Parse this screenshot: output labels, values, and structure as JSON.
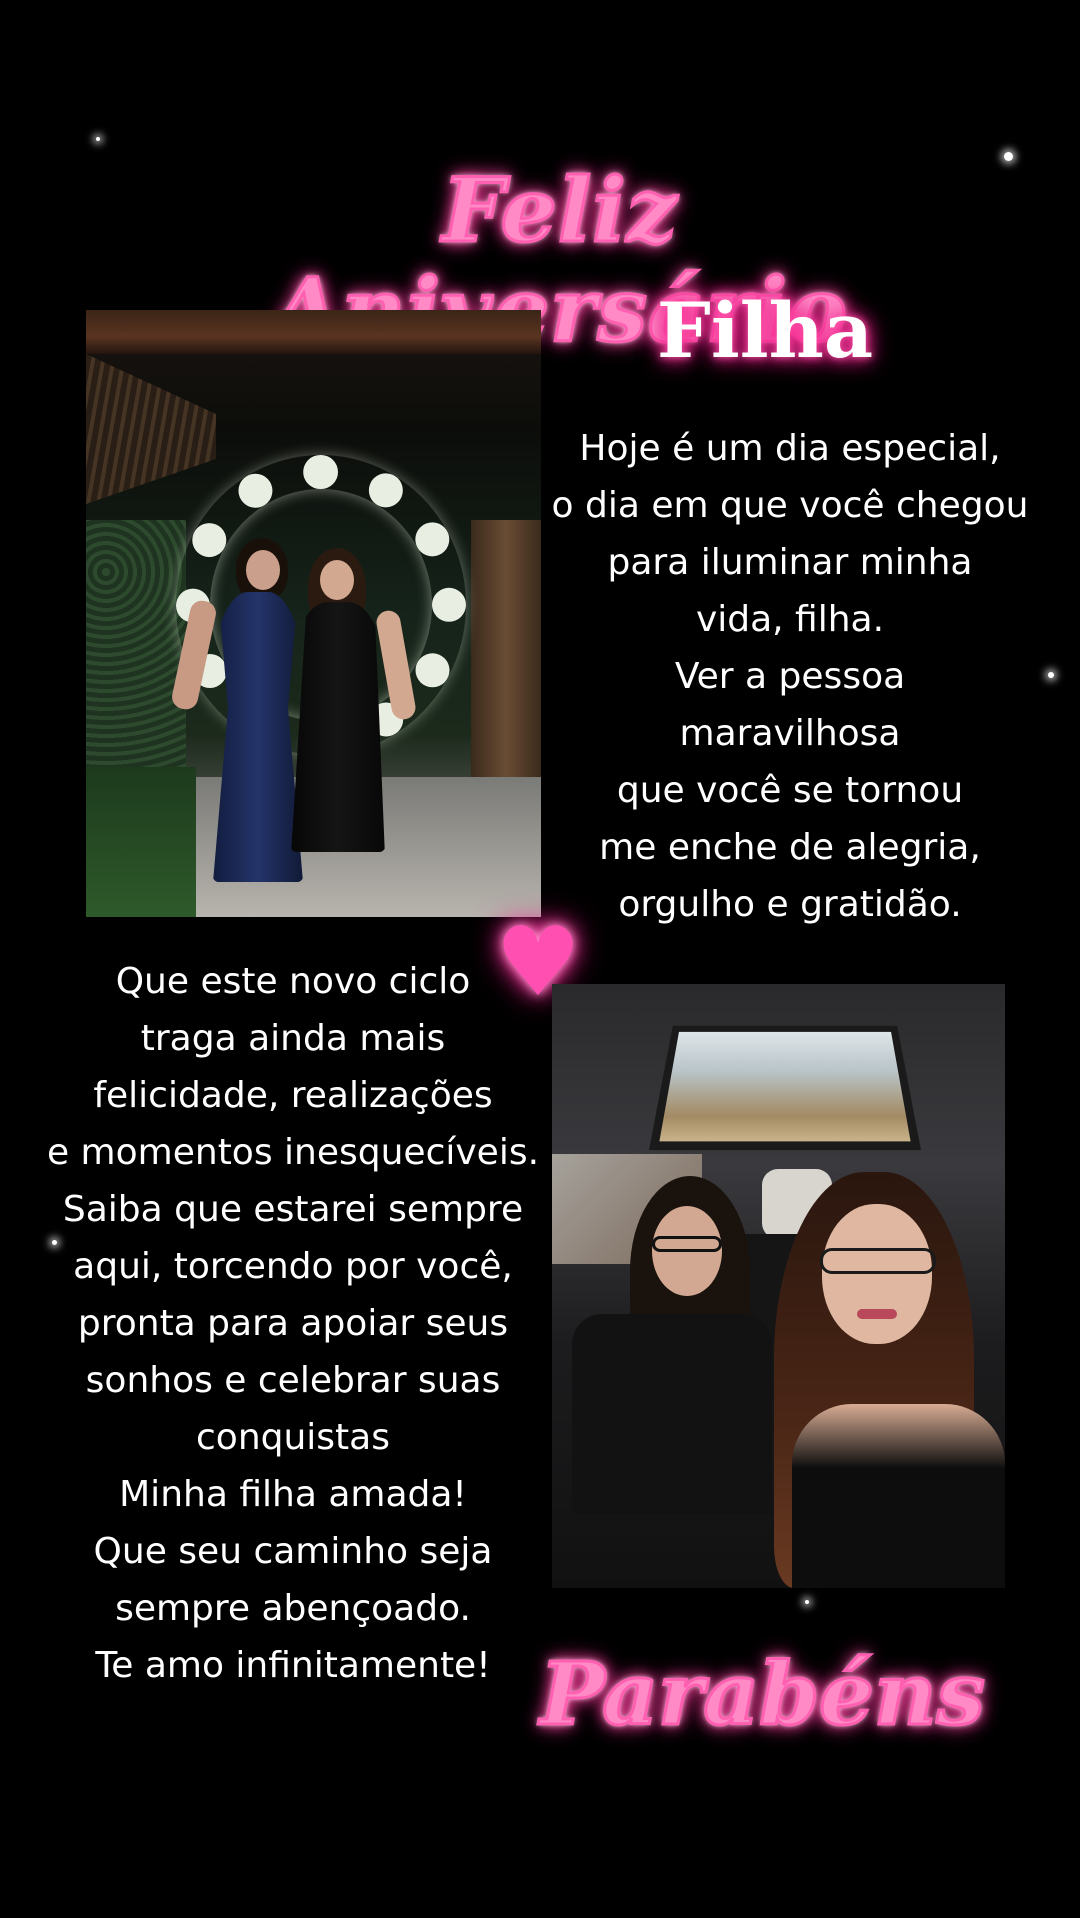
{
  "colors": {
    "background": "#000000",
    "title_pink": "#ff8ac6",
    "glow_pink": "#ff2d95",
    "text": "#ffffff"
  },
  "header": {
    "title": "Feliz Aniversário",
    "subtitle": "Filha"
  },
  "message_right": {
    "text": "Hoje é um dia especial,\no dia em que você chegou\npara iluminar minha\nvida, filha.\nVer a pessoa\nmaravilhosa\nque você se tornou\nme enche de alegria,\norgulho e gratidão."
  },
  "message_left": {
    "text": "Que este novo ciclo\ntraga ainda mais\nfelicidade, realizações\ne momentos inesquecíveis.\nSaiba que estarei sempre\naqui, torcendo por você,\npronta para apoiar seus\nsonhos e celebrar suas\nconquistas\nMinha filha amada!\nQue seu caminho seja\nsempre abençoado.\nTe amo infinitamente!"
  },
  "decoration": {
    "heart_icon": "pink-heart-icon",
    "heart_glyph": "♥"
  },
  "footer": {
    "closing": "Parabéns"
  }
}
